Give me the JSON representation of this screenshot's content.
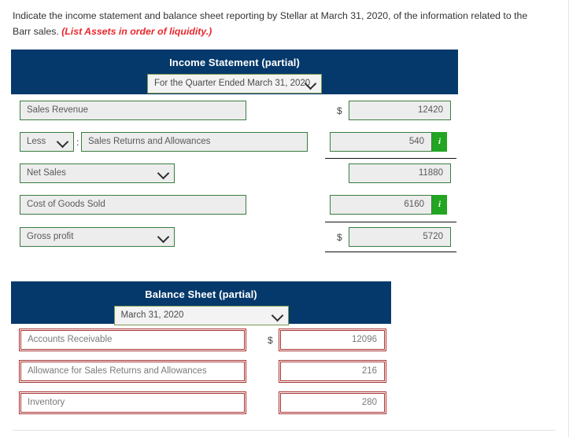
{
  "prompt": {
    "text": "Indicate the income statement and balance sheet reporting by Stellar at March 31, 2020, of the information related to the Barr sales.",
    "emphasis": "(List Assets in order of liquidity.)"
  },
  "income_statement": {
    "title": "Income Statement (partial)",
    "period_select": "For the Quarter Ended March 31, 2020",
    "dollar_symbol": "$",
    "rows": [
      {
        "label": "Sales Revenue",
        "label_type": "input",
        "dollar": "$",
        "amount": "12420",
        "info": false
      },
      {
        "prefix_select": "Less",
        "separator": ":",
        "label": "Sales Returns and Allowances",
        "label_type": "input",
        "dollar": "",
        "amount": "540",
        "info": true,
        "info_label": "i"
      },
      {
        "label": "Net Sales",
        "label_type": "select",
        "dollar": "",
        "amount": "11880",
        "info": false
      },
      {
        "label": "Cost of Goods Sold",
        "label_type": "input",
        "dollar": "",
        "amount": "6160",
        "info": true,
        "info_label": "i"
      },
      {
        "label": "Gross profit",
        "label_type": "select",
        "dollar": "$",
        "amount": "5720",
        "info": false
      }
    ]
  },
  "balance_sheet": {
    "title": "Balance Sheet (partial)",
    "date_select": "March 31, 2020",
    "rows": [
      {
        "label": "Accounts Receivable",
        "dollar": "$",
        "amount": "12096"
      },
      {
        "label": "Allowance for Sales Returns and Allowances",
        "dollar": "",
        "amount": "216"
      },
      {
        "label": "Inventory",
        "dollar": "",
        "amount": "280"
      }
    ]
  },
  "colors": {
    "header_navy": "#05396b",
    "accent_green": "#3a7d3f",
    "info_green": "#22a522",
    "error_red": "#a83232",
    "emphasis_red": "#e8272c"
  }
}
